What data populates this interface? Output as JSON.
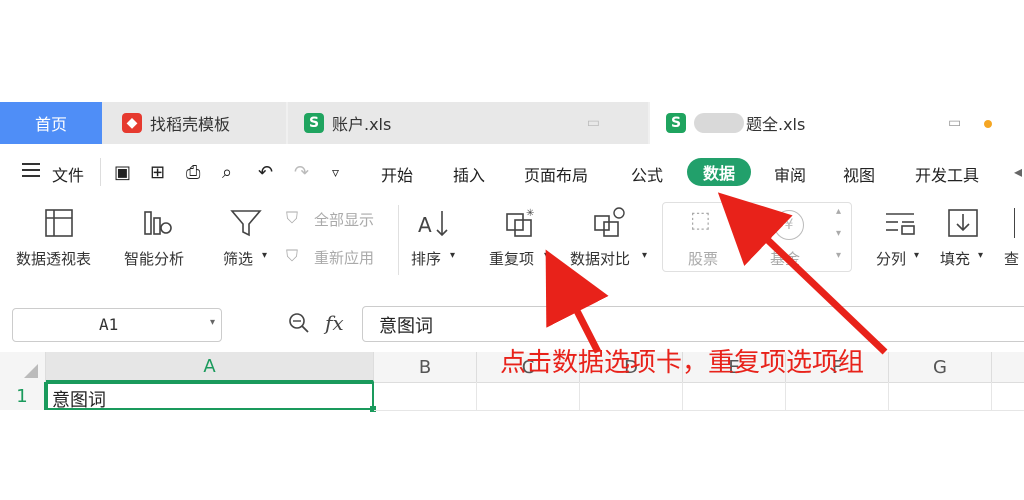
{
  "tabs": [
    {
      "label": "首页",
      "active": true
    },
    {
      "label": "找稻壳模板",
      "icon": "docer-icon"
    },
    {
      "label": "账户.xls",
      "icon": "spreadsheet-icon"
    },
    {
      "label": "题全.xls",
      "icon": "spreadsheet-icon"
    }
  ],
  "menu": {
    "file": "文件",
    "items": [
      "开始",
      "插入",
      "页面布局",
      "公式",
      "数据",
      "审阅",
      "视图",
      "开发工具"
    ],
    "active": "数据"
  },
  "ribbon": {
    "pivot": "数据透视表",
    "smart_analysis": "智能分析",
    "filter": "筛选",
    "show_all": "全部显示",
    "reapply": "重新应用",
    "sort": "排序",
    "duplicates": "重复项",
    "data_compare": "数据对比",
    "stocks": "股票",
    "fund": "基金",
    "split": "分列",
    "fill": "填充",
    "lookup": "查"
  },
  "formula_bar": {
    "cell_ref": "A1",
    "fx": "fx",
    "value": "意图词"
  },
  "grid": {
    "columns": [
      "A",
      "B",
      "C",
      "D",
      "E",
      "F",
      "G"
    ],
    "rows": [
      {
        "num": "1",
        "A": "意图词"
      }
    ]
  },
  "annotation": {
    "text": "点击数据选项卡，重复项选项组",
    "color": "#e8221a"
  },
  "colors": {
    "home_tab": "#4f8ef7",
    "data_tab": "#22a06b",
    "annotation": "#e8221a"
  }
}
